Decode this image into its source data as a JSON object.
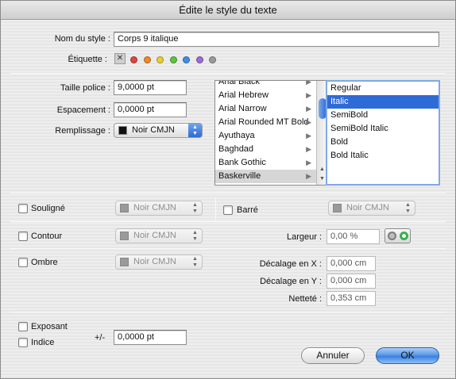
{
  "window": {
    "title": "Édite le style du texte"
  },
  "style_name": {
    "label": "Nom du style :",
    "value": "Corps 9 italique"
  },
  "etiquette": {
    "label": "Étiquette :",
    "none_glyph": "✕",
    "colors": [
      "#e0443d",
      "#f08a24",
      "#e9cf2f",
      "#5cc43f",
      "#3f8ce8",
      "#a06ad6",
      "#9a9a9a"
    ]
  },
  "font_size": {
    "label": "Taille police :",
    "value": "9,0000 pt"
  },
  "spacing": {
    "label": "Espacement :",
    "value": "0,0000 pt"
  },
  "fill": {
    "label": "Remplissage :",
    "value": "Noir CMJN",
    "swatch": "#111111"
  },
  "font_list": {
    "items": [
      "Arial Black",
      "Arial Hebrew",
      "Arial Narrow",
      "Arial Rounded MT Bold",
      "Ayuthaya",
      "Baghdad",
      "Bank Gothic",
      "Baskerville"
    ],
    "selected": "Baskerville",
    "submenu_arrow": "▶"
  },
  "style_list": {
    "items": [
      "Regular",
      "Italic",
      "SemiBold",
      "SemiBold Italic",
      "Bold",
      "Bold Italic"
    ],
    "selected": "Italic"
  },
  "underline": {
    "label": "Souligné",
    "color": "Noir CMJN"
  },
  "strike": {
    "label": "Barré",
    "color": "Noir CMJN"
  },
  "outline": {
    "label": "Contour",
    "color": "Noir CMJN",
    "width_label": "Largeur :",
    "width_value": "0,00 %"
  },
  "shadow": {
    "label": "Ombre",
    "color": "Noir CMJN",
    "offset_x_label": "Décalage en X :",
    "offset_x_value": "0,000 cm",
    "offset_y_label": "Décalage  en Y :",
    "offset_y_value": "0,000 cm",
    "sharpness_label": "Netteté :",
    "sharpness_value": "0,353 cm"
  },
  "superscript": {
    "label": "Exposant"
  },
  "subscript": {
    "label": "Indice"
  },
  "baseline": {
    "label": "+/-",
    "value": "0,0000 pt"
  },
  "buttons": {
    "cancel": "Annuler",
    "ok": "OK"
  },
  "icons": {
    "popup_arrows": "▲▼",
    "scroll_up": "▲",
    "scroll_down": "▼"
  }
}
